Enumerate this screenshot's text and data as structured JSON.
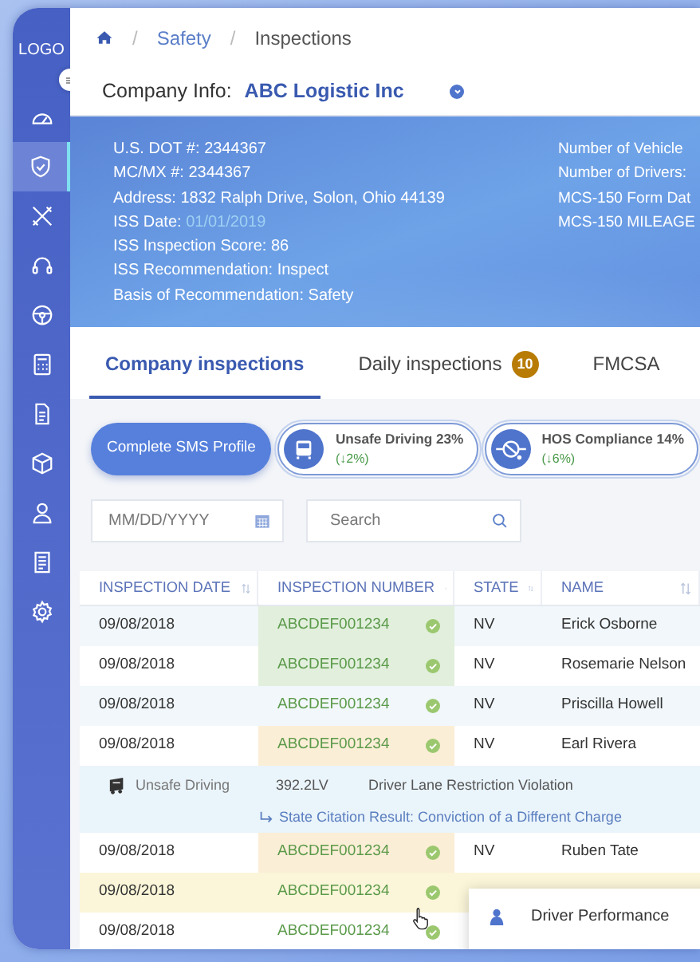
{
  "sidebar": {
    "logo": "LOGO",
    "items": [
      {
        "kind": "dashboard",
        "selected": false
      },
      {
        "kind": "shield",
        "selected": true
      },
      {
        "kind": "tools",
        "selected": false
      },
      {
        "kind": "headset",
        "selected": false
      },
      {
        "kind": "wheel",
        "selected": false
      },
      {
        "kind": "calculator",
        "selected": false
      },
      {
        "kind": "document",
        "selected": false
      },
      {
        "kind": "box",
        "selected": false
      },
      {
        "kind": "user",
        "selected": false
      },
      {
        "kind": "report",
        "selected": false
      },
      {
        "kind": "settings",
        "selected": false
      }
    ]
  },
  "breadcrumb": [
    {
      "separator": "/",
      "label": "Safety",
      "current": false
    },
    {
      "separator": "/",
      "label": "Inspections",
      "current": true
    }
  ],
  "company": {
    "label": "Company Info:",
    "value": "ABC Logistic Inc"
  },
  "info": {
    "left": [
      {
        "label": "U.S. DOT #:",
        "value": "2344367",
        "highlight": false
      },
      {
        "label": "MC/MX #:",
        "value": "2344367",
        "highlight": false
      },
      {
        "label": "Address:",
        "value": "1832  Ralph Drive, Solon, Ohio 44139",
        "highlight": false
      },
      {
        "label": "ISS Date:",
        "value": "01/01/2019",
        "highlight": true
      },
      {
        "label": "ISS Inspection Score:",
        "value": "86",
        "highlight": false
      },
      {
        "label": "ISS Recommendation:",
        "value": "Inspect",
        "highlight": false
      },
      {
        "label": "Basis of Recommendation:",
        "value": "Safety",
        "highlight": false
      }
    ],
    "right": [
      "Number of Vehicle",
      "Number of Drivers:",
      "MCS-150 Form Dat",
      "MCS-150 MILEAGE"
    ]
  },
  "tabs": [
    {
      "label": "Company inspections",
      "selected": true
    },
    {
      "label": "Daily inspections",
      "selected": false,
      "badge": "10"
    },
    {
      "label": "FMCSA",
      "selected": false
    }
  ],
  "sms_button": "Complete SMS Profile",
  "metrics": [
    {
      "kind": "bus",
      "title": "Unsafe Driving 23%",
      "change": "(↓2%)"
    },
    {
      "kind": "clock",
      "title": "HOS Compliance 14%",
      "change": "(↓6%)"
    }
  ],
  "filters": {
    "date_placeholder": "MM/DD/YYYY",
    "search_placeholder": "Search"
  },
  "table": {
    "columns": [
      "INSPECTION DATE",
      "INSPECTION NUMBER",
      "STATE",
      "NAME"
    ],
    "rows": [
      {
        "kind": "inspection",
        "date": "09/08/2018",
        "number": "ABCDEF001234",
        "verified": true,
        "state": "NV",
        "name": "Erick Osborne",
        "color": "#e1efdc",
        "hovered": false
      },
      {
        "kind": "inspection",
        "date": "09/08/2018",
        "number": "ABCDEF001234",
        "verified": true,
        "state": "NV",
        "name": "Rosemarie Nelson",
        "color": "#e1efdc",
        "hovered": false
      },
      {
        "kind": "inspection",
        "date": "09/08/2018",
        "number": "ABCDEF001234",
        "verified": true,
        "state": "NV",
        "name": "Priscilla Howell",
        "color": "#f1f7fa",
        "hovered": false
      },
      {
        "kind": "inspection",
        "date": "09/08/2018",
        "number": "ABCDEF001234",
        "verified": true,
        "state": "NV",
        "name": "Earl Rivera",
        "color": "#fbeed6",
        "hovered": false
      },
      {
        "kind": "detail",
        "category": "Unsafe Driving",
        "code": "392.2LV",
        "violation": "Driver Lane Restriction Violation",
        "result": "State Citation Result: Conviction of a Different Charge"
      },
      {
        "kind": "inspection",
        "date": "09/08/2018",
        "number": "ABCDEF001234",
        "verified": true,
        "state": "NV",
        "name": "Ruben Tate",
        "color": "#fbeed6",
        "hovered": false
      },
      {
        "kind": "inspection",
        "date": "09/08/2018",
        "number": "ABCDEF001234",
        "verified": true,
        "color": "#fbf6d9",
        "hovered": true
      },
      {
        "kind": "inspection",
        "date": "09/08/2018",
        "number": "ABCDEF001234",
        "verified": true,
        "color": "#ffffff",
        "hovered": false
      }
    ]
  },
  "context_menu": {
    "items": [
      {
        "kind": "driver",
        "label": "Driver Performance"
      }
    ]
  }
}
